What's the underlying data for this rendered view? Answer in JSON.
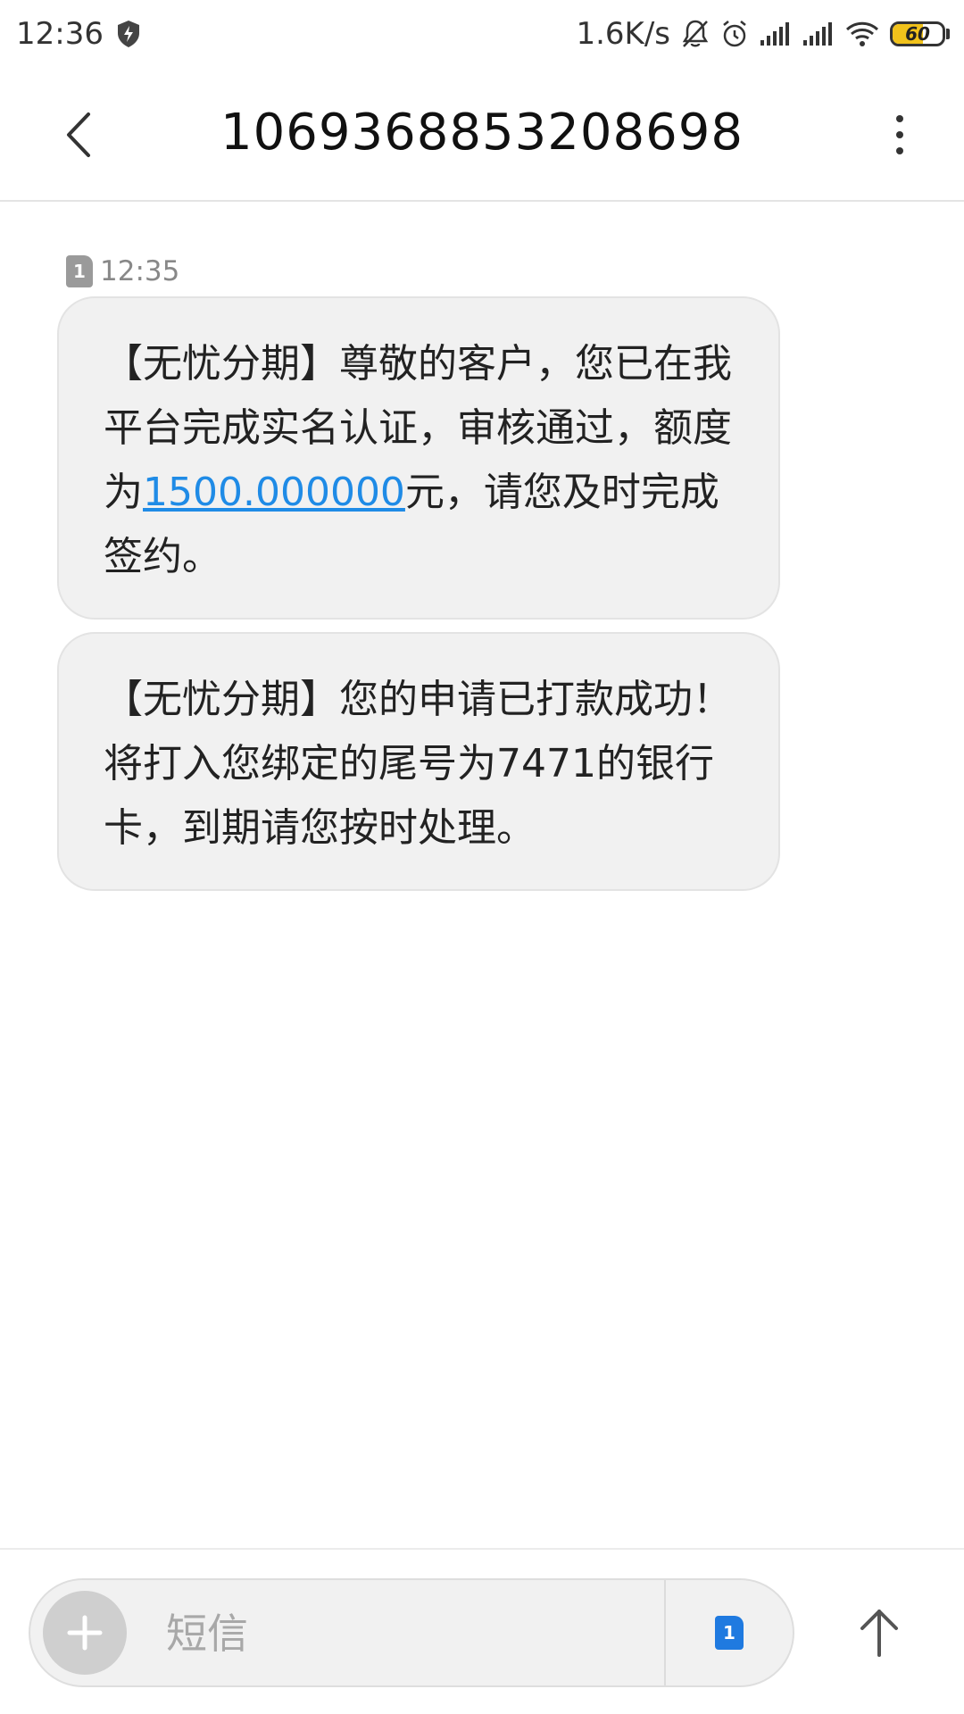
{
  "status_bar": {
    "time": "12:36",
    "net_speed": "1.6K/s",
    "battery": {
      "percent": 60,
      "label": "60",
      "color": "#f1c21b"
    },
    "icons": [
      "shield-bolt-icon",
      "mute-bell-icon",
      "alarm-icon",
      "signal-icon",
      "signal-icon",
      "wifi-icon",
      "battery-icon"
    ]
  },
  "header": {
    "title": "10693688532086​98",
    "back_icon": "chevron-left-icon",
    "more_icon": "more-vertical-icon"
  },
  "thread": {
    "sim_label": "1",
    "time": "12:35",
    "messages": [
      {
        "before_link": "【无忧分期】尊敬的客户，您已在我平台完成实名认证，审核通过，额度为",
        "link": "1500.000000",
        "after_link": "元，请您及时完成签约。"
      },
      {
        "text": "【无忧分期】您的申请已打款成功！将打入您绑定的尾号为7471的银行卡，到期请您按时处理。"
      }
    ]
  },
  "compose": {
    "placeholder": "短信",
    "value": "",
    "sim_label": "1",
    "accent": "#1f7ae0"
  }
}
